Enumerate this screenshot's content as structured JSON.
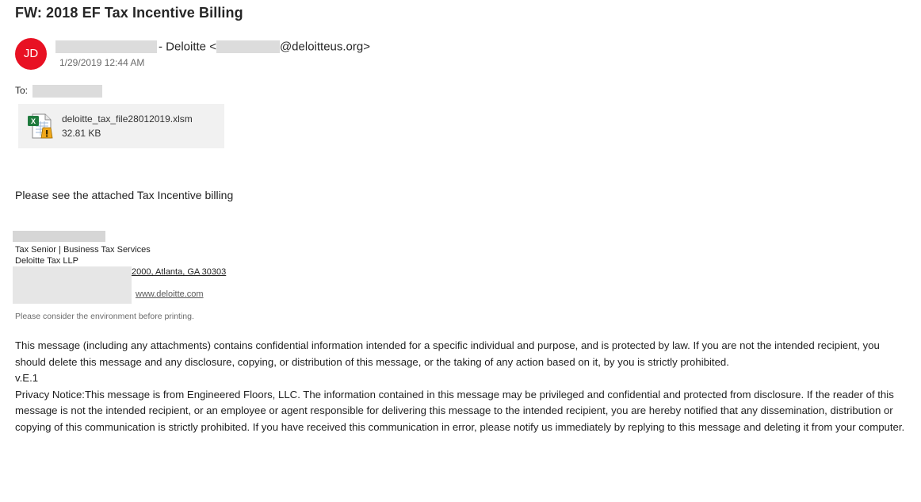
{
  "email": {
    "subject": "FW: 2018 EF Tax Incentive Billing",
    "avatar_initials": "JD",
    "avatar_color": "#e81123",
    "sender_mid": "- Deloitte <",
    "sender_domain": "@deloitteus.org>",
    "date": "1/29/2019 12:44 AM",
    "to_label": "To:"
  },
  "attachment": {
    "filename": "deloitte_tax_file28012019.xlsm",
    "size": "32.81 KB",
    "icon": "excel-macro-file-icon"
  },
  "body": {
    "message": "Please see the attached Tax Incentive billing"
  },
  "signature": {
    "title": "Tax Senior | Business Tax Services",
    "company": "Deloitte Tax LLP",
    "address": "2000, Atlanta, GA 30303",
    "website": "www.deloitte.com",
    "environment_note": "Please consider the environment before printing."
  },
  "disclaimer": {
    "confidential": "This message (including any attachments) contains confidential information intended for a specific individual and purpose, and is protected by law. If you are not the intended recipient, you should delete this message and any disclosure, copying, or distribution of this message, or the taking of any action based on it, by you is strictly prohibited.",
    "version": "v.E.1",
    "privacy": "Privacy Notice:This message is from Engineered Floors, LLC. The information contained in this message may be privileged and confidential and protected from disclosure. If the reader of this message is not the intended recipient, or an employee or agent responsible for delivering this message to the intended recipient, you are hereby notified that any dissemination, distribution or copying of this communication is strictly prohibited. If you have received this communication in error, please notify us immediately by replying to this message and deleting it from your computer."
  }
}
